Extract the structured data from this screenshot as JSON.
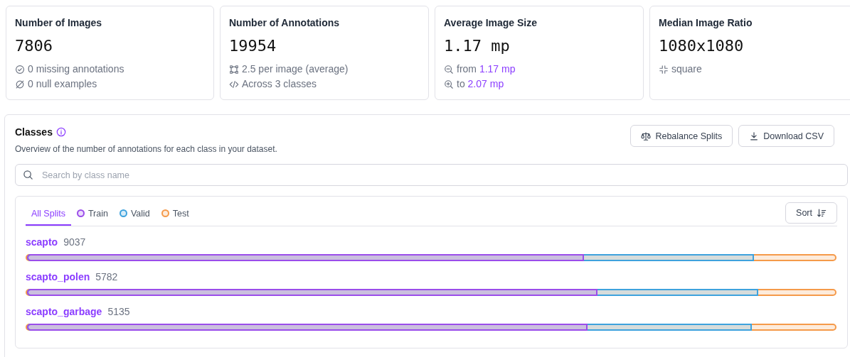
{
  "stats": [
    {
      "title": "Number of Images",
      "value": "7806",
      "lines": [
        {
          "kind": "check",
          "text": "0 missing annotations"
        },
        {
          "kind": "null",
          "text": "0 null examples"
        }
      ]
    },
    {
      "title": "Number of Annotations",
      "value": "19954",
      "lines": [
        {
          "kind": "box",
          "text": "2.5 per image (average)"
        },
        {
          "kind": "code",
          "text": "Across 3 classes"
        }
      ]
    },
    {
      "title": "Average Image Size",
      "value": "1.17 mp",
      "lines": [
        {
          "kind": "zoom-out",
          "text": "from",
          "highlight": "1.17 mp"
        },
        {
          "kind": "zoom-in",
          "text": "to",
          "highlight": "2.07 mp"
        }
      ]
    },
    {
      "title": "Median Image Ratio",
      "value": "1080x1080",
      "lines": [
        {
          "kind": "shrink",
          "text": "square"
        }
      ]
    }
  ],
  "classes": {
    "title": "Classes",
    "description": "Overview of the number of annotations for each class in your dataset.",
    "buttons": [
      {
        "kind": "scale",
        "label": "Rebalance Splits"
      },
      {
        "kind": "download",
        "label": "Download CSV"
      }
    ],
    "search": {
      "placeholder": "Search by class name"
    },
    "tabs": [
      {
        "label": "All Splits",
        "selected": true
      },
      {
        "label": "Train",
        "selected": false,
        "color": "#9b4dea"
      },
      {
        "label": "Valid",
        "selected": false,
        "color": "#3ea2dd"
      },
      {
        "label": "Test",
        "selected": false,
        "color": "#f59a4a"
      }
    ],
    "sort": {
      "label": "Sort"
    },
    "rows": [
      {
        "name": "scapto",
        "count": "9037",
        "bar": {
          "color": "#f59a4a",
          "fills": [
            {
              "color": "#3ea2dd",
              "level": 0.9
            },
            {
              "color": "#9b4dea",
              "level": 0.689
            }
          ]
        }
      },
      {
        "name": "scapto_polen",
        "count": "5782",
        "bar": {
          "color": "#f59a4a",
          "fills": [
            {
              "color": "#3ea2dd",
              "level": 0.905
            },
            {
              "color": "#9b4dea",
              "level": 0.706
            }
          ]
        }
      },
      {
        "name": "scapto_garbage",
        "count": "5135",
        "bar": {
          "color": "#f59a4a",
          "fills": [
            {
              "color": "#3ea2dd",
              "level": 0.897
            },
            {
              "color": "#9b4dea",
              "level": 0.694
            }
          ]
        }
      }
    ]
  }
}
